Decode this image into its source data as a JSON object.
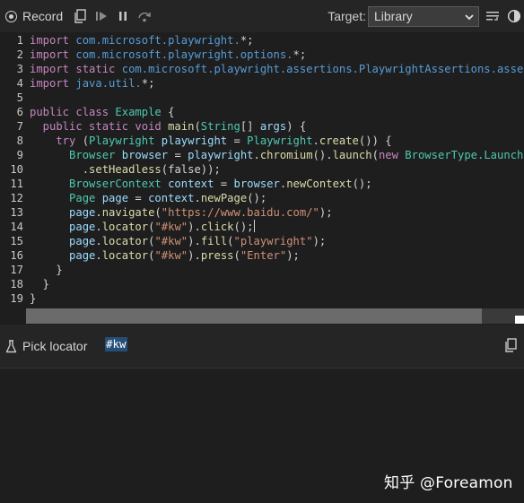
{
  "toolbar": {
    "record_label": "Record",
    "target_label": "Target:",
    "target_value": "Library"
  },
  "editor": {
    "line_numbers": [
      "1",
      "2",
      "3",
      "4",
      "5",
      "6",
      "7",
      "8",
      "9",
      "10",
      "11",
      "12",
      "13",
      "14",
      "15",
      "16",
      "17",
      "18",
      "19"
    ],
    "lines": [
      [
        {
          "t": "import ",
          "c": "kw"
        },
        {
          "t": "com.microsoft.playwright.",
          "c": "pkg"
        },
        {
          "t": "*;",
          "c": "pl"
        }
      ],
      [
        {
          "t": "import ",
          "c": "kw"
        },
        {
          "t": "com.microsoft.playwright.options.",
          "c": "pkg"
        },
        {
          "t": "*;",
          "c": "pl"
        }
      ],
      [
        {
          "t": "import static ",
          "c": "kw"
        },
        {
          "t": "com.microsoft.playwright.assertions.PlaywrightAssertions.assertT",
          "c": "pkg"
        }
      ],
      [
        {
          "t": "import ",
          "c": "kw"
        },
        {
          "t": "java.util.",
          "c": "pkg"
        },
        {
          "t": "*;",
          "c": "pl"
        }
      ],
      [],
      [
        {
          "t": "public class ",
          "c": "kw"
        },
        {
          "t": "Example",
          "c": "ty"
        },
        {
          "t": " {",
          "c": "pl"
        }
      ],
      [
        {
          "t": "  public static void ",
          "c": "kw"
        },
        {
          "t": "main",
          "c": "fn"
        },
        {
          "t": "(",
          "c": "pl"
        },
        {
          "t": "String",
          "c": "ty"
        },
        {
          "t": "[] ",
          "c": "pl"
        },
        {
          "t": "args",
          "c": "var"
        },
        {
          "t": ") {",
          "c": "pl"
        }
      ],
      [
        {
          "t": "    try ",
          "c": "kw"
        },
        {
          "t": "(",
          "c": "pl"
        },
        {
          "t": "Playwright ",
          "c": "ty"
        },
        {
          "t": "playwright",
          "c": "var"
        },
        {
          "t": " = ",
          "c": "pl"
        },
        {
          "t": "Playwright",
          "c": "ty"
        },
        {
          "t": ".",
          "c": "pl"
        },
        {
          "t": "create",
          "c": "fn"
        },
        {
          "t": "()) {",
          "c": "pl"
        }
      ],
      [
        {
          "t": "      Browser ",
          "c": "ty"
        },
        {
          "t": "browser",
          "c": "var"
        },
        {
          "t": " = ",
          "c": "pl"
        },
        {
          "t": "playwright",
          "c": "var"
        },
        {
          "t": ".",
          "c": "pl"
        },
        {
          "t": "chromium",
          "c": "fn"
        },
        {
          "t": "().",
          "c": "pl"
        },
        {
          "t": "launch",
          "c": "fn"
        },
        {
          "t": "(",
          "c": "pl"
        },
        {
          "t": "new ",
          "c": "kw"
        },
        {
          "t": "BrowserType.LaunchOpt",
          "c": "ty"
        }
      ],
      [
        {
          "t": "        .",
          "c": "pl"
        },
        {
          "t": "setHeadless",
          "c": "fn"
        },
        {
          "t": "(false));",
          "c": "pl"
        }
      ],
      [
        {
          "t": "      BrowserContext ",
          "c": "ty"
        },
        {
          "t": "context",
          "c": "var"
        },
        {
          "t": " = ",
          "c": "pl"
        },
        {
          "t": "browser",
          "c": "var"
        },
        {
          "t": ".",
          "c": "pl"
        },
        {
          "t": "newContext",
          "c": "fn"
        },
        {
          "t": "();",
          "c": "pl"
        }
      ],
      [
        {
          "t": "      Page ",
          "c": "ty"
        },
        {
          "t": "page",
          "c": "var"
        },
        {
          "t": " = ",
          "c": "pl"
        },
        {
          "t": "context",
          "c": "var"
        },
        {
          "t": ".",
          "c": "pl"
        },
        {
          "t": "newPage",
          "c": "fn"
        },
        {
          "t": "();",
          "c": "pl"
        }
      ],
      [
        {
          "t": "      page",
          "c": "var"
        },
        {
          "t": ".",
          "c": "pl"
        },
        {
          "t": "navigate",
          "c": "fn"
        },
        {
          "t": "(",
          "c": "pl"
        },
        {
          "t": "\"https://www.baidu.com/\"",
          "c": "str"
        },
        {
          "t": ");",
          "c": "pl"
        }
      ],
      [
        {
          "t": "      page",
          "c": "var"
        },
        {
          "t": ".",
          "c": "pl"
        },
        {
          "t": "locator",
          "c": "fn"
        },
        {
          "t": "(",
          "c": "pl"
        },
        {
          "t": "\"#kw\"",
          "c": "str"
        },
        {
          "t": ").",
          "c": "pl"
        },
        {
          "t": "click",
          "c": "fn"
        },
        {
          "t": "();",
          "c": "pl"
        },
        {
          "t": "",
          "c": "cursor"
        }
      ],
      [
        {
          "t": "      page",
          "c": "var"
        },
        {
          "t": ".",
          "c": "pl"
        },
        {
          "t": "locator",
          "c": "fn"
        },
        {
          "t": "(",
          "c": "pl"
        },
        {
          "t": "\"#kw\"",
          "c": "str"
        },
        {
          "t": ").",
          "c": "pl"
        },
        {
          "t": "fill",
          "c": "fn"
        },
        {
          "t": "(",
          "c": "pl"
        },
        {
          "t": "\"playwright\"",
          "c": "str"
        },
        {
          "t": ");",
          "c": "pl"
        }
      ],
      [
        {
          "t": "      page",
          "c": "var"
        },
        {
          "t": ".",
          "c": "pl"
        },
        {
          "t": "locator",
          "c": "fn"
        },
        {
          "t": "(",
          "c": "pl"
        },
        {
          "t": "\"#kw\"",
          "c": "str"
        },
        {
          "t": ").",
          "c": "pl"
        },
        {
          "t": "press",
          "c": "fn"
        },
        {
          "t": "(",
          "c": "pl"
        },
        {
          "t": "\"Enter\"",
          "c": "str"
        },
        {
          "t": ");",
          "c": "pl"
        }
      ],
      [
        {
          "t": "    }",
          "c": "pl"
        }
      ],
      [
        {
          "t": "  }",
          "c": "pl"
        }
      ],
      [
        {
          "t": "}",
          "c": "pl"
        }
      ]
    ]
  },
  "locator": {
    "pick_label": "Pick locator",
    "value": "#kw"
  },
  "watermark": "知乎 @Foreamon",
  "icons": {
    "record": "record-icon",
    "copy": "copy-icon",
    "resume": "resume-icon",
    "pause": "pause-icon",
    "step_over": "step-over-icon",
    "target_dropdown": "chevron-down-icon",
    "wrap": "wrap-lines-icon",
    "theme": "theme-toggle-icon",
    "pick": "pick-locator-icon",
    "locator_copy": "copy-icon"
  },
  "colors": {
    "keyword": "#c586c0",
    "package": "#569cd6",
    "type": "#4ec9b0",
    "function": "#dcdcaa",
    "variable": "#9cdcfe",
    "string": "#ce9178",
    "selection": "#264f78"
  }
}
